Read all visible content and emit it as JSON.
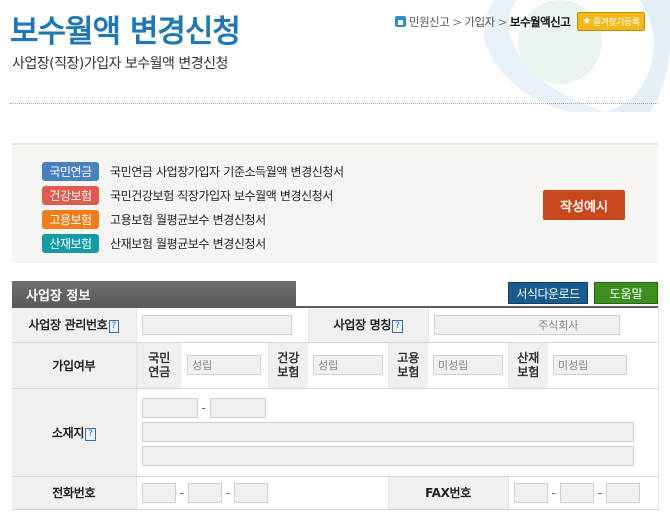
{
  "header": {
    "title": "보수월액 변경신청",
    "subtitle": "사업장(직장)가입자 보수월액 변경신청",
    "breadcrumb": [
      "민원신고",
      "가입자",
      "보수월액신고"
    ],
    "breadcrumb_sep": ">",
    "favorite_label": "즐겨찾기등록"
  },
  "forms": [
    {
      "badge": "국민연금",
      "text": "국민연금 사업장가입자 기준소득월액 변경신청서",
      "color": "#4a7fc0"
    },
    {
      "badge": "건강보험",
      "text": "국민건강보험 직장가입자 보수월액 변경신청서",
      "color": "#e05a4f"
    },
    {
      "badge": "고용보험",
      "text": "고용보험 월평균보수 변경신청서",
      "color": "#ee7d1c"
    },
    {
      "badge": "산재보험",
      "text": "산재보험 월평균보수 변경신청서",
      "color": "#139ba6"
    }
  ],
  "example_button": "작성예시",
  "section": {
    "title": "사업장 정보",
    "download_button": "서식다운로드",
    "help_button": "도움말"
  },
  "table": {
    "mgmt_no_label": "사업장 관리번호",
    "biz_name_label": "사업장 명칭",
    "biz_name_value": "주식회사",
    "help_icon": "?",
    "join_label": "가입여부",
    "pension_label": "국민\n연금",
    "pension_value": "성립",
    "health_label": "건강\n보험",
    "health_value": "성립",
    "employment_label": "고용\n보험",
    "employment_value": "미성립",
    "industrial_label": "산재\n보험",
    "industrial_value": "미성립",
    "address_label": "소재지",
    "phone_label": "전화번호",
    "fax_label": "FAX번호",
    "dash": "-"
  },
  "colors": {
    "title": "#1f78b4",
    "example_button": "#c9471c",
    "download_button": "#1a5b8e",
    "help_button": "#3c8f1f"
  }
}
